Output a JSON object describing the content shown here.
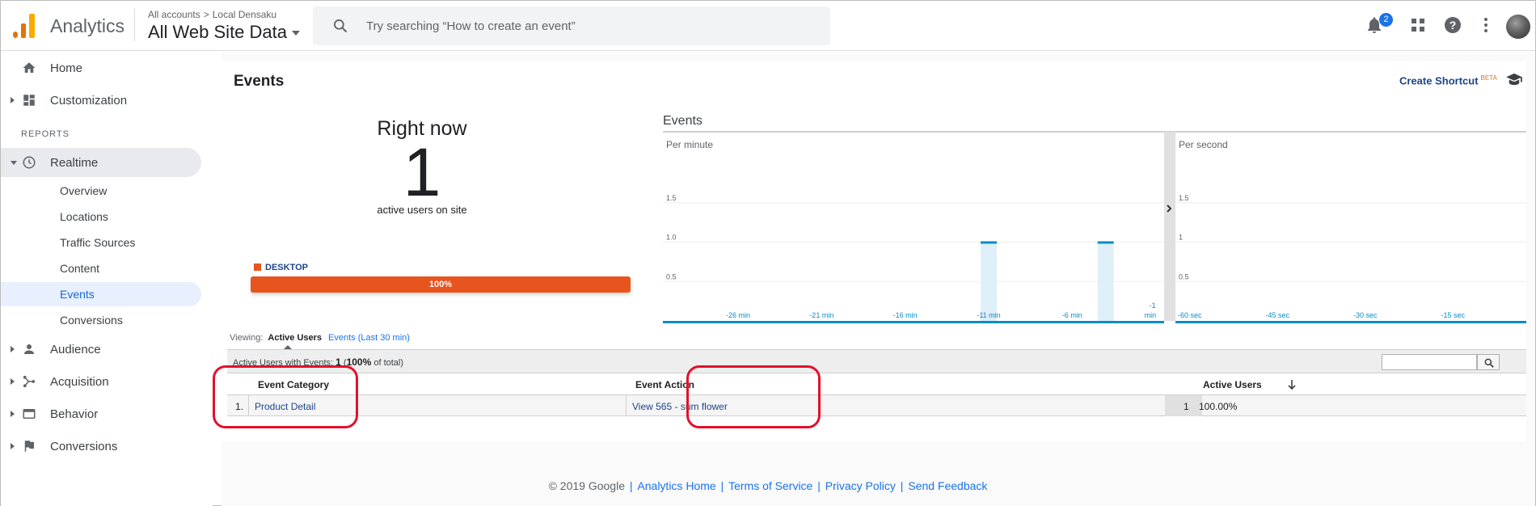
{
  "header": {
    "app_name": "Analytics",
    "breadcrumb": [
      "All accounts",
      "Local Densaku"
    ],
    "property": "All Web Site Data",
    "search_placeholder": "Try searching “How to create an event”",
    "notification_count": "2"
  },
  "sidebar": {
    "items": [
      {
        "label": "Home",
        "icon": "home-icon"
      },
      {
        "label": "Customization",
        "icon": "dashboard-icon"
      }
    ],
    "reports_label": "REPORTS",
    "realtime": {
      "label": "Realtime",
      "icon": "clock-icon"
    },
    "realtime_sub": [
      "Overview",
      "Locations",
      "Traffic Sources",
      "Content",
      "Events",
      "Conversions"
    ],
    "active_sub": "Events",
    "groups": [
      {
        "label": "Audience",
        "icon": "person-icon"
      },
      {
        "label": "Acquisition",
        "icon": "acquisition-icon"
      },
      {
        "label": "Behavior",
        "icon": "behavior-icon"
      },
      {
        "label": "Conversions",
        "icon": "flag-icon"
      }
    ]
  },
  "main": {
    "title": "Events",
    "shortcut_label": "Create Shortcut",
    "shortcut_badge": "BETA",
    "right_now": {
      "title": "Right now",
      "value": "1",
      "subtitle": "active users on site",
      "device_label": "DESKTOP",
      "device_percent": "100%"
    },
    "events_chart_title": "Events",
    "viewing": {
      "label": "Viewing:",
      "active_tab": "Active Users",
      "other_tab": "Events (Last 30 min)"
    },
    "summary": {
      "prefix": "Active Users with Events:",
      "count": "1",
      "open": " (",
      "percent": "100%",
      "suffix": " of total)"
    },
    "table": {
      "columns": [
        "Event Category",
        "Event Action",
        "Active Users"
      ],
      "rows": [
        {
          "index": "1.",
          "category": "Product Detail",
          "action": "View 565 - sum flower",
          "users": "1",
          "percent": "100.00%"
        }
      ]
    }
  },
  "chart_data": [
    {
      "type": "bar",
      "title": "Per minute",
      "x_ticks": [
        "-26 min",
        "-21 min",
        "-16 min",
        "-11 min",
        "-6 min",
        "-1 min"
      ],
      "y_ticks": [
        "0.5",
        "1.0",
        "1.5"
      ],
      "ylim": [
        0,
        2
      ],
      "x": [
        -30,
        -29,
        -28,
        -27,
        -26,
        -25,
        -24,
        -23,
        -22,
        -21,
        -20,
        -19,
        -18,
        -17,
        -16,
        -15,
        -14,
        -13,
        -12,
        -11,
        -10,
        -9,
        -8,
        -7,
        -6,
        -5,
        -4,
        -3,
        -2,
        -1
      ],
      "values": [
        0,
        0,
        0,
        0,
        0,
        0,
        0,
        0,
        0,
        0,
        0,
        0,
        0,
        0,
        0,
        0,
        0,
        0,
        0,
        1,
        0,
        0,
        0,
        0,
        0,
        0,
        1,
        0,
        0,
        0
      ]
    },
    {
      "type": "bar",
      "title": "Per second",
      "x_ticks": [
        "-60 sec",
        "-45 sec",
        "-30 sec",
        "-15 sec"
      ],
      "y_ticks": [
        "0.5",
        "1",
        "1.5"
      ],
      "ylim": [
        0,
        2
      ],
      "values": []
    }
  ],
  "footer": {
    "copyright": "© 2019 Google",
    "links": [
      "Analytics Home",
      "Terms of Service",
      "Privacy Policy",
      "Send Feedback"
    ]
  },
  "colors": {
    "accent": "#1a73e8",
    "device_bar": "#e8541e",
    "highlight": "#e3112b"
  }
}
